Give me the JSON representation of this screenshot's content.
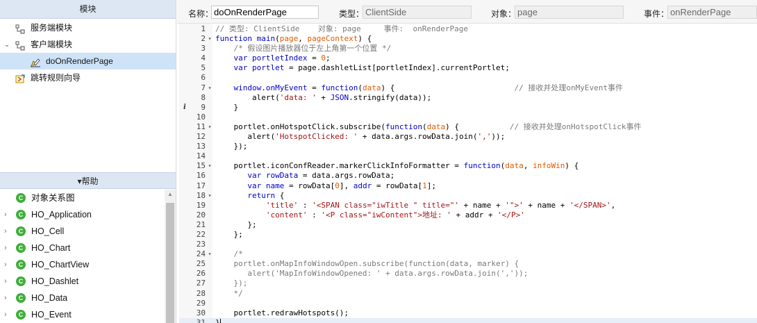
{
  "left": {
    "modules_header": "模块",
    "tree": [
      {
        "label": "服务端模块",
        "level": 0,
        "arrow": "",
        "icon": "server-modules-icon"
      },
      {
        "label": "客户端模块",
        "level": 0,
        "arrow": "⌄",
        "icon": "client-modules-icon"
      },
      {
        "label": "doOnRenderPage",
        "level": 1,
        "arrow": "",
        "icon": "edit-script-icon",
        "selected": true
      },
      {
        "label": "跳转规则向导",
        "level": 0,
        "arrow": "",
        "icon": "jump-wizard-icon"
      }
    ],
    "help_header": "▾帮助",
    "help_items": [
      {
        "label": "对象关系图",
        "arrow": ""
      },
      {
        "label": "HO_Application",
        "arrow": "›"
      },
      {
        "label": "HO_Cell",
        "arrow": "›"
      },
      {
        "label": "HO_Chart",
        "arrow": "›"
      },
      {
        "label": "HO_ChartView",
        "arrow": "›"
      },
      {
        "label": "HO_Dashlet",
        "arrow": "›"
      },
      {
        "label": "HO_Data",
        "arrow": "›"
      },
      {
        "label": "HO_Event",
        "arrow": "›"
      }
    ],
    "help_badge": "C"
  },
  "props": {
    "name_label": "名称：",
    "name_value": "doOnRenderPage",
    "type_label": "类型：",
    "type_value": "ClientSide",
    "object_label": "对象：",
    "object_value": "page",
    "event_label": "事件：",
    "event_value": "onRenderPage"
  },
  "editor": {
    "lines": [
      {
        "n": "1",
        "fold": "",
        "html": "<span class=\"cm\">// 类型: ClientSide    对象: page     事件:  onRenderPage</span>"
      },
      {
        "n": "2",
        "fold": "▾",
        "html": "<span class=\"kw\">function</span> <span class=\"kw\">main</span>(<span class=\"pm\">page</span>, <span class=\"pm\">pageContext</span>) {"
      },
      {
        "n": "3",
        "fold": "",
        "html": "    <span class=\"cm\">/* 假设图片播放器位于左上角第一个位置 */</span>"
      },
      {
        "n": "4",
        "fold": "",
        "html": "    <span class=\"kw\">var</span> <span class=\"kw\">portletIndex</span> = <span class=\"nu\">0</span>;"
      },
      {
        "n": "5",
        "fold": "",
        "html": "    <span class=\"kw\">var</span> <span class=\"kw\">portlet</span> = page.dashletList[portletIndex].currentPortlet;"
      },
      {
        "n": "6",
        "fold": "",
        "html": ""
      },
      {
        "n": "7",
        "fold": "▾",
        "html": "    <span class=\"kw\">window</span>.<span class=\"kw\">onMyEvent</span> = <span class=\"kw\">function</span>(<span class=\"pm\">data</span>) {                          <span class=\"cm\">// 接收并处理onMyEvent事件</span>"
      },
      {
        "n": "8",
        "fold": "",
        "html": "        alert(<span class=\"st\">'data: '</span> + <span class=\"cn\">JSON</span>.stringify(data));"
      },
      {
        "n": "9",
        "fold": "",
        "html": "    }",
        "info": "i"
      },
      {
        "n": "10",
        "fold": "",
        "html": ""
      },
      {
        "n": "11",
        "fold": "▾",
        "html": "    portlet.onHotspotClick.subscribe(<span class=\"kw\">function</span>(<span class=\"pm\">data</span>) {           <span class=\"cm\">// 接收并处理onHotspotClick事件</span>"
      },
      {
        "n": "12",
        "fold": "",
        "html": "       alert(<span class=\"st\">'HotspotClicked: '</span> + data.args.rowData.join(<span class=\"st\">','</span>));"
      },
      {
        "n": "13",
        "fold": "",
        "html": "    });"
      },
      {
        "n": "14",
        "fold": "",
        "html": ""
      },
      {
        "n": "15",
        "fold": "▾",
        "html": "    portlet.iconConfReader.markerClickInfoFormatter = <span class=\"kw\">function</span>(<span class=\"pm\">data</span>, <span class=\"pm\">infoWin</span>) {"
      },
      {
        "n": "16",
        "fold": "",
        "html": "       <span class=\"kw\">var</span> <span class=\"kw\">rowData</span> = data.args.rowData;"
      },
      {
        "n": "17",
        "fold": "",
        "html": "       <span class=\"kw\">var</span> <span class=\"kw\">name</span> = rowData[<span class=\"nu\">0</span>], <span class=\"kw\">addr</span> = rowData[<span class=\"nu\">1</span>];"
      },
      {
        "n": "18",
        "fold": "▾",
        "html": "       <span class=\"kw\">return</span> {"
      },
      {
        "n": "19",
        "fold": "",
        "html": "           <span class=\"st\">'title'</span> : <span class=\"st\">'&lt;SPAN class=\"iwTitle \" title=\"'</span> + name + <span class=\"st\">'\"&gt;'</span> + name + <span class=\"st\">'&lt;/SPAN&gt;'</span>,"
      },
      {
        "n": "20",
        "fold": "",
        "html": "           <span class=\"st\">'content'</span> : <span class=\"st\">'&lt;P class=\"iwContent\"&gt;地址: '</span> + addr + <span class=\"st\">'&lt;/P&gt;'</span>"
      },
      {
        "n": "21",
        "fold": "",
        "html": "       };"
      },
      {
        "n": "22",
        "fold": "",
        "html": "    };"
      },
      {
        "n": "23",
        "fold": "",
        "html": ""
      },
      {
        "n": "24",
        "fold": "▾",
        "html": "    <span class=\"cm\">/*</span>"
      },
      {
        "n": "25",
        "fold": "",
        "html": "    <span class=\"cm\">portlet.onMapInfoWindowOpen.subscribe(function(data, marker) {</span>"
      },
      {
        "n": "26",
        "fold": "",
        "html": "       <span class=\"cm\">alert('MapInfoWindowOpened: ' + data.args.rowData.join(','));</span>"
      },
      {
        "n": "27",
        "fold": "",
        "html": "    <span class=\"cm\">});</span>"
      },
      {
        "n": "28",
        "fold": "",
        "html": "    <span class=\"cm\">*/</span>"
      },
      {
        "n": "29",
        "fold": "",
        "html": ""
      },
      {
        "n": "30",
        "fold": "",
        "html": "    portlet.redrawHotspots();"
      },
      {
        "n": "31",
        "fold": "",
        "html": "}<span class=\"cursor\"></span>",
        "current": true
      }
    ]
  }
}
